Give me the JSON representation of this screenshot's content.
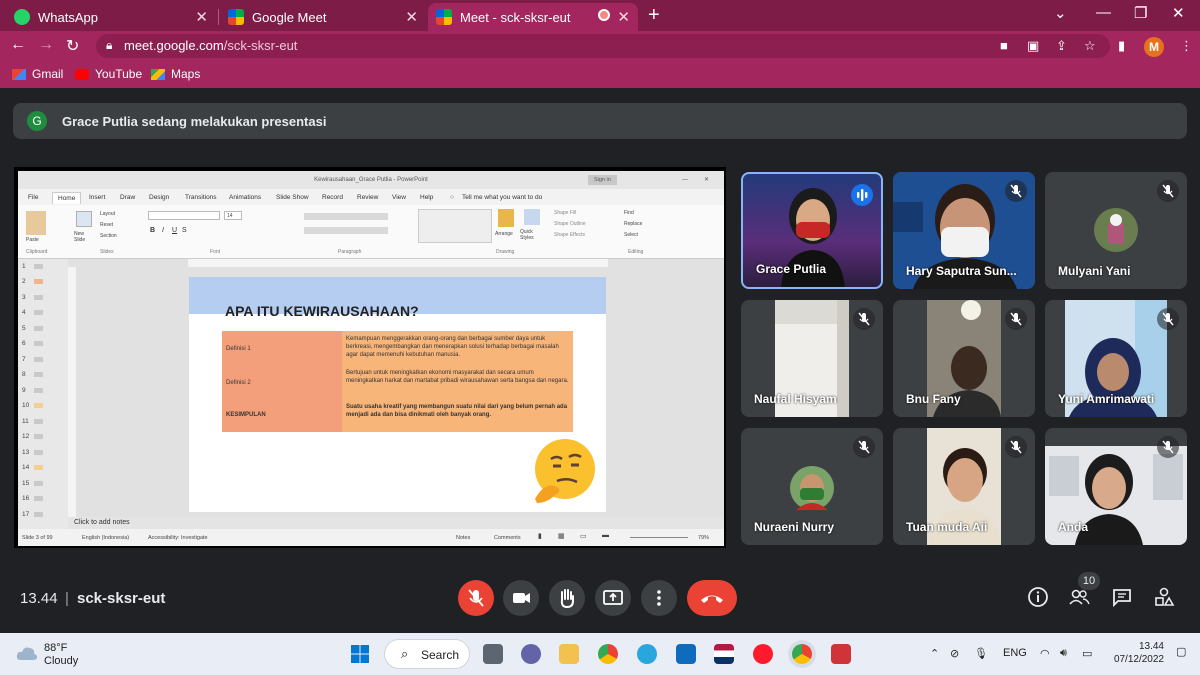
{
  "browser": {
    "tabs": [
      {
        "label": "WhatsApp",
        "active": false,
        "favicon_color": "#25d366"
      },
      {
        "label": "Google Meet",
        "active": false,
        "favicon_color": "#00ac47"
      },
      {
        "label": "Meet - sck-sksr-eut",
        "active": true,
        "favicon_color": "#00ac47"
      }
    ],
    "url_host": "meet.google.com",
    "url_path": "/sck-sksr-eut",
    "profile_initial": "M",
    "bookmarks": [
      "Gmail",
      "YouTube",
      "Maps"
    ]
  },
  "meet": {
    "presenter_initial": "G",
    "presenting_text": "Grace Putlia sedang melakukan presentasi",
    "time": "13.44",
    "separator": "|",
    "meeting_code": "sck-sksr-eut",
    "people_count": "10",
    "participants": [
      {
        "name": "Grace Putlia",
        "speaking": true
      },
      {
        "name": "Hary Saputra Sun...",
        "speaking": false
      },
      {
        "name": "Mulyani Yani",
        "speaking": false
      },
      {
        "name": "Naufal Hisyam",
        "speaking": false
      },
      {
        "name": "Bnu Fany",
        "speaking": false
      },
      {
        "name": "Yuni Amrimawati",
        "speaking": false
      },
      {
        "name": "Nuraeni Nurry",
        "speaking": false
      },
      {
        "name": "Tuan muda Aii",
        "speaking": false
      },
      {
        "name": "Anda",
        "speaking": false
      }
    ]
  },
  "powerpoint": {
    "window_title": "Kewirausahaan_Grace Putlia - PowerPoint",
    "signin": "Sign in",
    "ribbon_tabs": [
      "File",
      "Home",
      "Insert",
      "Draw",
      "Design",
      "Transitions",
      "Animations",
      "Slide Show",
      "Record",
      "Review",
      "View",
      "Help"
    ],
    "tell_me": "Tell me what you want to do",
    "groups": [
      "Clipboard",
      "Slides",
      "Font",
      "Paragraph",
      "Drawing",
      "Editing"
    ],
    "ribbon_items": {
      "paste": "Paste",
      "new_slide": "New Slide",
      "layout": "Layout",
      "reset": "Reset",
      "section": "Section",
      "arrange": "Arrange",
      "quick_styles": "Quick Styles",
      "shape_fill": "Shape Fill",
      "shape_outline": "Shape Outline",
      "shape_effects": "Shape Effects",
      "find": "Find",
      "replace": "Replace",
      "select": "Select",
      "font_size": "14"
    },
    "slide_numbers": [
      "1",
      "2",
      "3",
      "4",
      "5",
      "6",
      "7",
      "8",
      "9",
      "10",
      "11",
      "12",
      "13",
      "14",
      "15",
      "16",
      "17"
    ],
    "slide": {
      "title": "APA ITU KEWIRAUSAHAAN?",
      "rows": [
        {
          "label": "Definisi 1",
          "text": "Kemampuan menggerakkan orang-orang dan berbagai sumber daya untuk berkreasi, mengembangkan dan menerapkan solusi terhadap berbagai masalah agar dapat memenuhi kebutuhan manusia."
        },
        {
          "label": "Definisi 2",
          "text": "Bertujuan untuk meningkatkan ekonomi masyarakat dan secara umum meningkatkan harkat dan martabat pribadi wirausahawan serta bangsa dan negara."
        },
        {
          "label": "KESIMPULAN",
          "text": "Suatu usaha kreatif yang membangun suatu nilai dari yang belum pernah ada menjadi ada dan bisa dinikmati oleh banyak orang."
        }
      ]
    },
    "notes_placeholder": "Click to add notes",
    "status": {
      "slide_of": "Slide 3 of 99",
      "language": "English (Indonesia)",
      "accessibility": "Accessibility: Investigate",
      "notes": "Notes",
      "comments": "Comments",
      "zoom": "79%"
    }
  },
  "taskbar": {
    "temperature": "88°F",
    "condition": "Cloudy",
    "search": "Search",
    "lang": "ENG",
    "time": "13.44",
    "date": "07/12/2022"
  },
  "colors": {
    "tab_bar": "#7d1d47",
    "toolbar": "#a3265e",
    "meet_bg": "#202124",
    "tile_bg": "#3c4043",
    "accent_red": "#ea4335",
    "speaking_blue": "#1a73e8"
  }
}
